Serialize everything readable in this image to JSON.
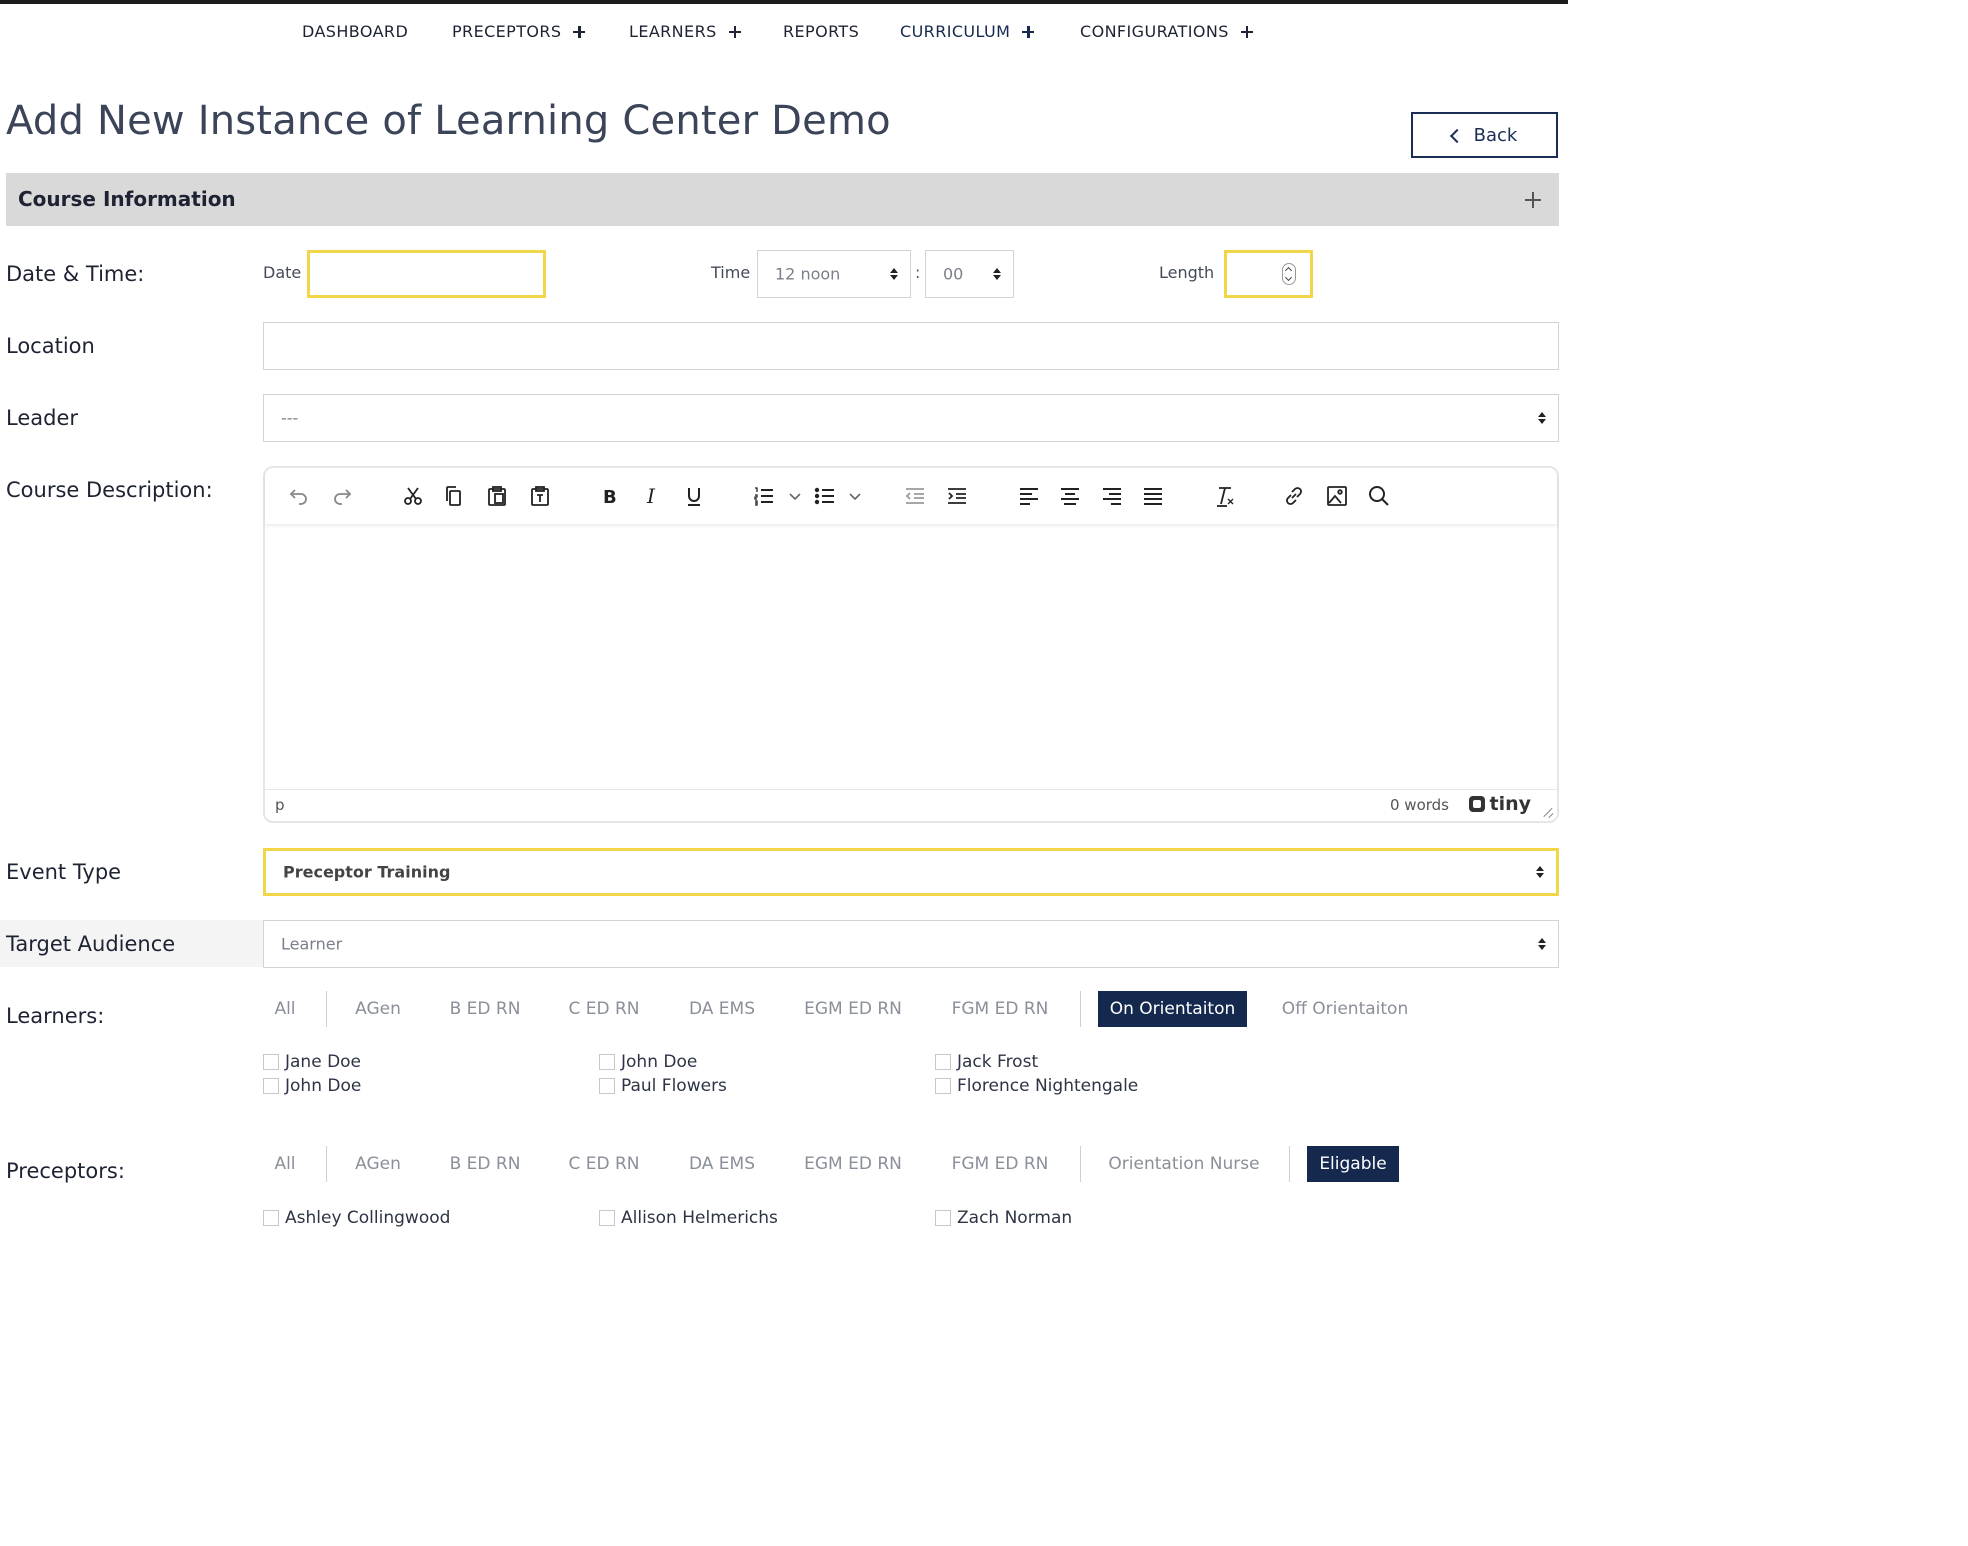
{
  "nav": {
    "items": [
      {
        "label": "DASHBOARD",
        "has_plus": false
      },
      {
        "label": "PRECEPTORS",
        "has_plus": true
      },
      {
        "label": "LEARNERS",
        "has_plus": true
      },
      {
        "label": "REPORTS",
        "has_plus": false
      },
      {
        "label": "CURRICULUM",
        "has_plus": true,
        "active": true
      },
      {
        "label": "CONFIGURATIONS",
        "has_plus": true
      }
    ]
  },
  "page": {
    "title": "Add New Instance of Learning Center Demo",
    "back_label": "Back"
  },
  "section": {
    "title": "Course Information"
  },
  "form": {
    "date_time_label": "Date & Time:",
    "date_label": "Date",
    "date_value": "",
    "time_label": "Time",
    "time_hour": "12 noon",
    "time_separator": ":",
    "time_minute": "00",
    "length_label": "Length",
    "length_value": "",
    "location_label": "Location",
    "location_value": "",
    "leader_label": "Leader",
    "leader_value": "---",
    "description_label": "Course Description:",
    "event_type_label": "Event Type",
    "event_type_value": "Preceptor Training",
    "target_audience_label": "Target Audience",
    "target_audience_value": "Learner"
  },
  "editor": {
    "toolbar": [
      "undo-icon",
      "redo-icon",
      "cut-icon",
      "copy-icon",
      "paste-icon",
      "paste-text-icon",
      "bold-icon",
      "italic-icon",
      "underline-icon",
      "numbered-list-icon",
      "bullet-list-icon",
      "outdent-icon",
      "indent-icon",
      "align-left-icon",
      "align-center-icon",
      "align-right-icon",
      "align-justify-icon",
      "clear-format-icon",
      "link-icon",
      "image-icon",
      "search-icon"
    ],
    "status_path": "p",
    "word_count": "0 words",
    "brand": "tiny"
  },
  "learners": {
    "label": "Learners:",
    "filters": [
      "All",
      "AGen",
      "B ED RN",
      "C ED RN",
      "DA EMS",
      "EGM ED RN",
      "FGM ED RN",
      "On Orientaiton",
      "Off Orientaiton"
    ],
    "active_filter": "On Orientaiton",
    "people": [
      "Jane Doe",
      "John Doe",
      "Jack Frost",
      "John Doe",
      "Paul Flowers",
      "Florence Nightengale"
    ]
  },
  "preceptors": {
    "label": "Preceptors:",
    "filters": [
      "All",
      "AGen",
      "B ED RN",
      "C ED RN",
      "DA EMS",
      "EGM ED RN",
      "FGM ED RN",
      "Orientation Nurse",
      "Eligable"
    ],
    "active_filter": "Eligable",
    "people": [
      "Ashley Collingwood",
      "Allison Helmerichs",
      "Zach Norman"
    ]
  },
  "colors": {
    "accent": "#15294f",
    "highlight_border": "#f2d649",
    "section_bg": "#d9d9d9"
  }
}
